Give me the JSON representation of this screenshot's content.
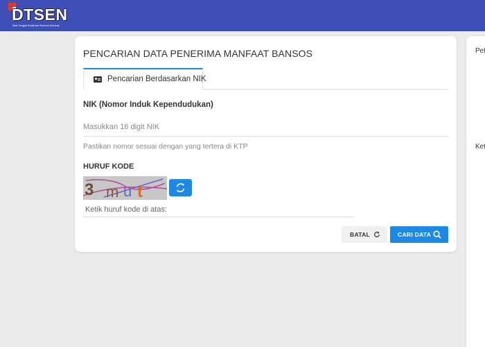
{
  "header": {
    "logo_text": "DTSEN",
    "logo_tagline": "Data Tunggal Sosial dan Ekonomi Nasional",
    "bg_color": "#3f4fb8"
  },
  "search_card": {
    "title": "PENCARIAN DATA PENERIMA MANFAAT BANSOS",
    "tab": {
      "label": "Pencarian Berdasarkan NIK",
      "icon": "id-card-icon",
      "active": true
    },
    "nik_label": "NIK (Nomor Induk Kependudukan)",
    "nik_input": {
      "value": "",
      "placeholder": "Masukkan 16 digit NIK"
    },
    "nik_help": "Pastikan nomor sesuai dengan yang tertera di KTP",
    "kode_label": "HURUF KODE",
    "captcha": {
      "text": "3 mut"
    },
    "refresh_icon": "refresh-icon",
    "captcha_input": {
      "value": "",
      "placeholder": "Ketik huruf kode di atas:"
    },
    "batal_label": "BATAL",
    "batal_icon": "reset-icon",
    "cari_label": "CARI DATA",
    "cari_icon": "search-icon",
    "accent_color": "#1e88e5"
  },
  "side_card": {
    "text1": "Pet",
    "text2": "Ket"
  }
}
